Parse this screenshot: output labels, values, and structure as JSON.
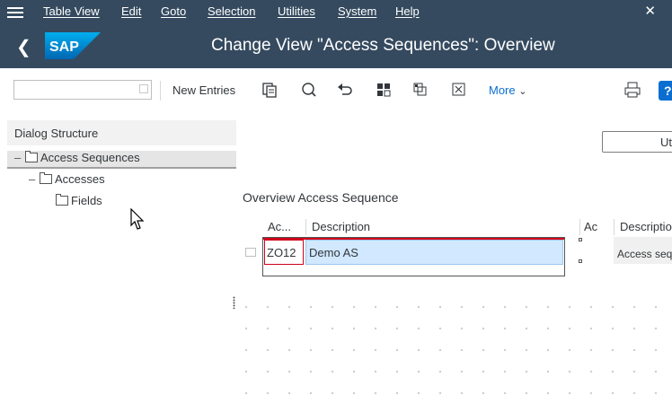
{
  "menubar": {
    "items": [
      "Table View",
      "Edit",
      "Goto",
      "Selection",
      "Utilities",
      "System",
      "Help"
    ]
  },
  "titlebar": {
    "title": "Change View \"Access Sequences\": Overview",
    "logo": "SAP"
  },
  "toolbar": {
    "input_value": "",
    "new_entries_label": "New Entries",
    "more_label": "More",
    "icons": [
      "copy-icon",
      "find-icon",
      "undo-icon",
      "select-all-icon",
      "select-block-icon",
      "deselect-all-icon",
      "print-icon",
      "help-icon"
    ]
  },
  "dialog_structure": {
    "title": "Dialog Structure",
    "items": [
      {
        "label": "Access Sequences",
        "level": 0,
        "selected": true
      },
      {
        "label": "Accesses",
        "level": 1,
        "selected": false
      },
      {
        "label": "Fields",
        "level": 2,
        "selected": false
      }
    ]
  },
  "right_button_label": "Ut",
  "overview": {
    "title": "Overview Access Sequence",
    "columns": [
      "Ac...",
      "Description",
      "Ac",
      "Descriptio"
    ],
    "rows": [
      {
        "access": "ZO12",
        "description": "Demo AS",
        "right_desc": "Access seq"
      }
    ]
  },
  "colors": {
    "shell": "#354a5f",
    "selection": "#d1e8ff",
    "error_border": "#d0021b",
    "link": "#0a6ed1"
  }
}
